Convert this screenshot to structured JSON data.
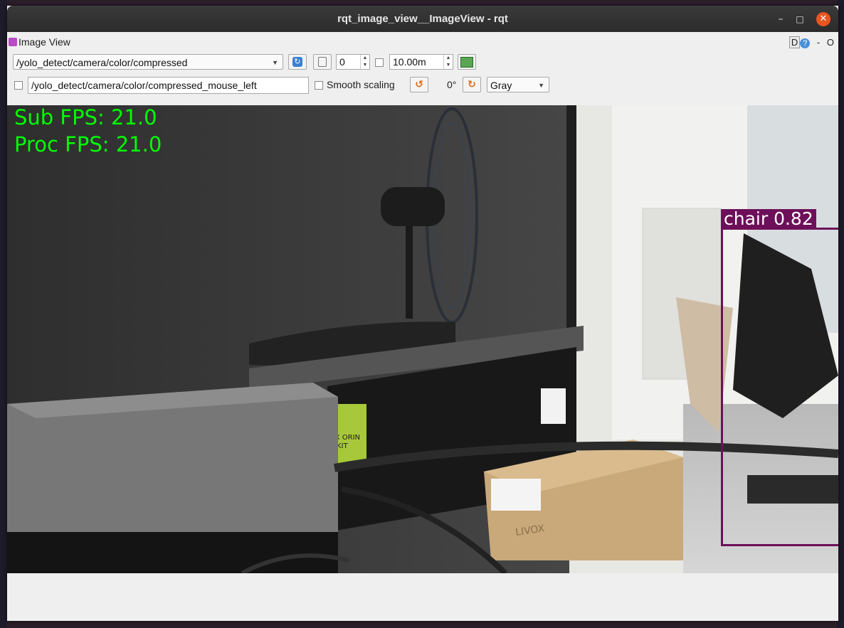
{
  "window": {
    "title": "rqt_image_view__ImageView - rqt",
    "min_glyph": "–",
    "max_glyph": "□",
    "close_glyph": "✕"
  },
  "plugin": {
    "title": "Image View",
    "d_button": "D",
    "help_button": "?",
    "minus_button": "-",
    "o_button": "O"
  },
  "toolbar": {
    "topic": "/yolo_detect/camera/color/compressed",
    "refresh_icon": "refresh-icon",
    "frame_index": "0",
    "timeout_value": "10.00m",
    "save_icon": "save-image-icon",
    "mouse_topic": "/yolo_detect/camera/color/compressed_mouse_left",
    "smooth_scaling_label": "Smooth scaling",
    "rotation": "0°",
    "color_scheme": "Gray"
  },
  "image": {
    "sub_fps": "Sub FPS: 21.0",
    "proc_fps": "Proc FPS: 21.0",
    "detection_label": "chair 0.82",
    "detection_color": "#6e0f5a",
    "box_text_1": "GX ORIN",
    "box_text_2": "R KIT",
    "carton_brand": "LIVOX"
  }
}
